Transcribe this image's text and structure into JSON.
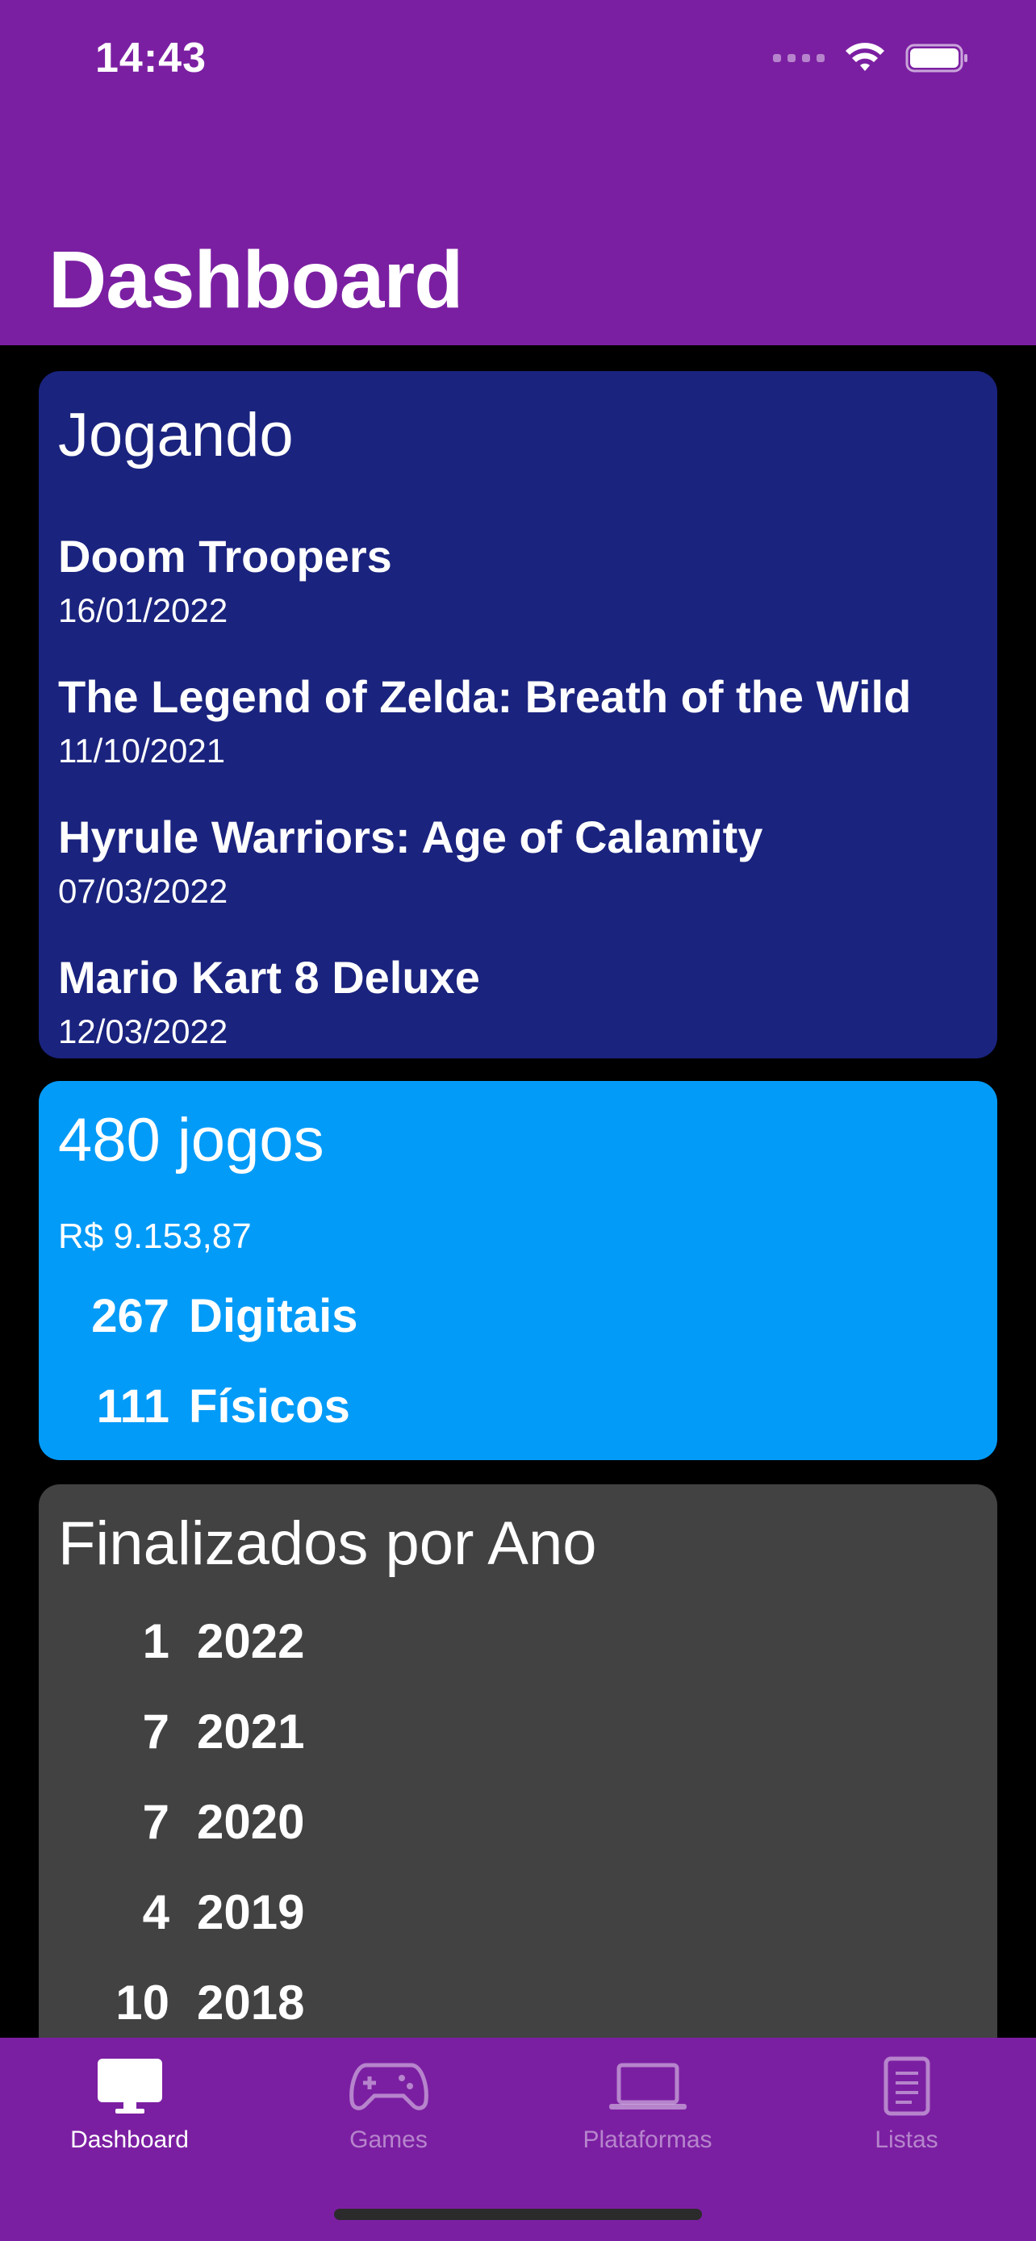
{
  "status_bar": {
    "time": "14:43",
    "icons": [
      "signal-icon",
      "wifi-icon",
      "battery-icon"
    ]
  },
  "header": {
    "title": "Dashboard"
  },
  "playing_card": {
    "title": "Jogando",
    "games": [
      {
        "name": "Doom Troopers",
        "date": "16/01/2022"
      },
      {
        "name": "The Legend of Zelda: Breath of the Wild",
        "date": "11/10/2021"
      },
      {
        "name": "Hyrule Warriors: Age of Calamity",
        "date": "07/03/2022"
      },
      {
        "name": "Mario Kart 8 Deluxe",
        "date": "12/03/2022"
      }
    ]
  },
  "stats_card": {
    "title": "480 jogos",
    "price": "R$ 9.153,87",
    "rows": [
      {
        "count": "267",
        "label": "Digitais"
      },
      {
        "count": "111",
        "label": "Físicos"
      }
    ]
  },
  "years_card": {
    "title": "Finalizados por Ano",
    "rows": [
      {
        "count": "1",
        "year": "2022"
      },
      {
        "count": "7",
        "year": "2021"
      },
      {
        "count": "7",
        "year": "2020"
      },
      {
        "count": "4",
        "year": "2019"
      },
      {
        "count": "10",
        "year": "2018"
      }
    ]
  },
  "tabbar": {
    "tabs": [
      {
        "label": "Dashboard",
        "icon": "desktop-icon",
        "active": true
      },
      {
        "label": "Games",
        "icon": "gamepad-icon",
        "active": false
      },
      {
        "label": "Plataformas",
        "icon": "laptop-icon",
        "active": false
      },
      {
        "label": "Listas",
        "icon": "list-icon",
        "active": false
      }
    ]
  },
  "colors": {
    "header_bg": "#7B1FA2",
    "playing_card_bg": "#1A237E",
    "stats_card_bg": "#039BF8",
    "years_card_bg": "#424242",
    "tabbar_bg": "#7B1FA2",
    "page_bg": "#000000"
  }
}
